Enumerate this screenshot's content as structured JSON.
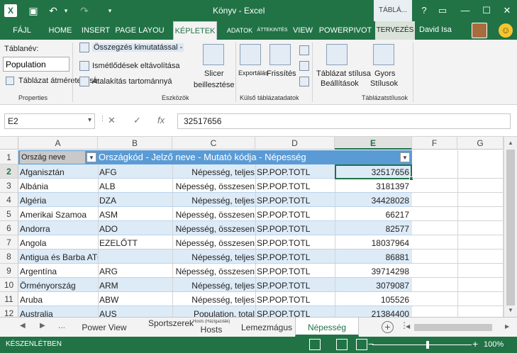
{
  "window": {
    "title": "Könyv - Excel",
    "context_tab": "TÁBLÁ...",
    "help": "?",
    "restore": "▭",
    "minimize": "—",
    "maximize": "☐",
    "close": "✕"
  },
  "ribbon_tabs": [
    {
      "label": "FÁJL"
    },
    {
      "label": "HOME"
    },
    {
      "label": "INSERT"
    },
    {
      "label": "PAGE LAYOU"
    },
    {
      "label": "KÉPLETEK"
    },
    {
      "label": "ADATOK"
    },
    {
      "label": "ÁTTEKINTÉS"
    },
    {
      "label": "VIEW"
    },
    {
      "label": "POWERPIVOT"
    },
    {
      "label": "TERVEZÉS"
    }
  ],
  "user": {
    "name": "David Isa"
  },
  "ribbon": {
    "table_name_label": "Táblanév:",
    "table_name_value": "Population",
    "resize_table": "Táblázat átméretezése",
    "properties_group": "Properties",
    "summarize_pivot": "Összegzés kimutatással -",
    "remove_duplicates": "Ismétlődések eltávolítása",
    "convert_to_range": "Átalakítás tartománnyá",
    "tools_group": "Eszközök",
    "insert_slicer_1": "Slicer",
    "insert_slicer_2": "beillesztése",
    "export": "Exportálás",
    "refresh": "Frissítés",
    "external_group": "Külső táblázatadatok",
    "style_options_1": "Táblázat stílusa",
    "style_options_2": "Beállítások",
    "quick_styles_1": "Gyors",
    "quick_styles_2": "Stílusok",
    "styles_group": "Táblázatstílusok"
  },
  "formula_bar": {
    "name_box": "E2",
    "cancel": "✕",
    "enter": "✓",
    "fx": "fx",
    "value": "32517656"
  },
  "columns": [
    "A",
    "B",
    "C",
    "D",
    "E",
    "F",
    "G"
  ],
  "table": {
    "header_a": "Ország neve",
    "header_rest": "Országkód - Jelző neve - Mutató kódja - Népesség",
    "rows": [
      {
        "row": "2",
        "country": "Afganisztán",
        "code": "AFG",
        "indicator": "Népesség, teljes",
        "indicator_code": "SP.POP.TOTL",
        "value": "32517656"
      },
      {
        "row": "3",
        "country": "Albánia",
        "code": "ALB",
        "indicator": "Népesség, összesen",
        "indicator_code": "SP.POP.TOTL",
        "value": "3181397"
      },
      {
        "row": "4",
        "country": "Algéria",
        "code": "DZA",
        "indicator": "Népesség, teljes",
        "indicator_code": "SP.POP.TOTL",
        "value": "34428028"
      },
      {
        "row": "5",
        "country": "Amerikai Szamoa",
        "code": "ASM",
        "indicator": "Népesség, összesen",
        "indicator_code": "SP.POP.TOTL",
        "value": "66217"
      },
      {
        "row": "6",
        "country": "Andorra",
        "code": "ADO",
        "indicator": "Népesség, összesen",
        "indicator_code": "SP.POP.TOTL",
        "value": "82577"
      },
      {
        "row": "7",
        "country": "Angola",
        "code": "EZELŐTT",
        "indicator": "Népesség, összesen",
        "indicator_code": "SP.POP.TOTL",
        "value": "18037964"
      },
      {
        "row": "8",
        "country": "Antigua és Barba ATG",
        "code": "",
        "indicator": "Népesség, teljes",
        "indicator_code": "SP.POP.TOTL",
        "value": "86881"
      },
      {
        "row": "9",
        "country": "Argentína",
        "code": "ARG",
        "indicator": "Népesség, összesen",
        "indicator_code": "SP.POP.TOTL",
        "value": "39714298"
      },
      {
        "row": "10",
        "country": "Örményország",
        "code": "ARM",
        "indicator": "Népesség, teljes",
        "indicator_code": "SP.POP.TOTL",
        "value": "3079087"
      },
      {
        "row": "11",
        "country": "Aruba",
        "code": "ABW",
        "indicator": "Népesség, teljes",
        "indicator_code": "SP.POP.TOTL",
        "value": "105526"
      },
      {
        "row": "12",
        "country": "Australia",
        "code": "AUS",
        "indicator": "Population, total",
        "indicator_code": "SP.POP.TOTL",
        "value": "21384400"
      }
    ]
  },
  "header_row_number": "1",
  "sheets": {
    "ellipsis": "...",
    "tabs": [
      {
        "label": "Power View"
      },
      {
        "label": "Sportszerek"
      },
      {
        "label": "Hosts"
      },
      {
        "label": "Lemezmágus"
      },
      {
        "label": "Népesség"
      }
    ],
    "tiny_label": "Hosts (Házigazdák)",
    "add": "+"
  },
  "status": {
    "ready": "KÉSZENLÉTBEN",
    "zoom": "100%",
    "zoom_minus": "−",
    "zoom_plus": "+"
  },
  "colors": {
    "excel_green": "#217346",
    "table_header": "#5b9bd5",
    "band": "#ddebf7"
  }
}
